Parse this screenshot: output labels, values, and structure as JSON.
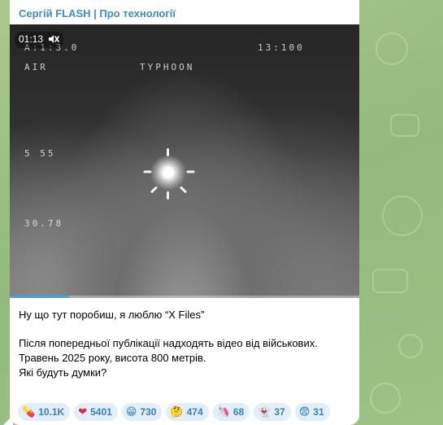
{
  "message": {
    "channel_name": "Сергій FLASH | Про технології",
    "video": {
      "time": "01:13",
      "muted_icon": "speaker-muted-icon",
      "progress": 0.17,
      "osd": {
        "top_left": "A:1:3.0",
        "top_left_2": "AIR",
        "title": "TYPHOON",
        "top_right": "13:100",
        "mid_left": "5 55",
        "bottom_left": "30.78"
      }
    },
    "caption": {
      "line1": "Ну що тут поробиш, я люблю “X Files”",
      "line2": "Після попередньої публікації надходять відео від військових.",
      "line3": "Травень 2025 року, висота 800 метрів.",
      "line4": "Які будуть думки?"
    },
    "reactions": [
      {
        "emoji": "💊",
        "count": "10.1K"
      },
      {
        "emoji": "❤",
        "count": "5401"
      },
      {
        "emoji": "😁",
        "count": "730"
      },
      {
        "emoji": "🤔",
        "count": "474"
      },
      {
        "emoji": "🦄",
        "count": "68"
      },
      {
        "emoji": "👻",
        "count": "37"
      },
      {
        "emoji": "😨",
        "count": "31"
      }
    ]
  },
  "colors": {
    "accent": "#3a8fc4",
    "wallpaper": "#9cc08a",
    "reaction_bg": "#e2eef9"
  }
}
